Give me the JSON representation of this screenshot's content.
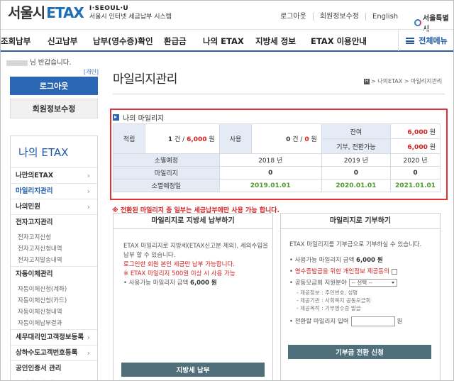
{
  "header": {
    "logo_main": "서울시",
    "logo_etax": "ETAX",
    "logo_sub1": "I·SEOUL·U",
    "logo_sub2": "서울시 인터넷 세금납부 시스템",
    "links": [
      "로그아웃",
      "회원정보수정",
      "English"
    ],
    "seoul_logo": "서울특별시"
  },
  "nav": {
    "items": [
      "조회납부",
      "신고납부",
      "납부(영수증)확인",
      "환급금",
      "나의 ETAX",
      "지방세 정보",
      "ETAX 이용안내"
    ],
    "all_menu": "전체메뉴"
  },
  "sidebar": {
    "greeting": "님 반갑습니다.",
    "open_label": "[개인]",
    "logout_label": "로그아웃",
    "member_edit_label": "회원정보수정",
    "title": "나의 ETAX",
    "items": [
      {
        "label": "나만의ETAX",
        "active": false,
        "subs": []
      },
      {
        "label": "마일리지관리",
        "active": true,
        "subs": []
      },
      {
        "label": "나의민원",
        "active": false,
        "subs": []
      },
      {
        "label": "전자고지관리",
        "active": false,
        "subs": [
          "전자고지신청",
          "전자고지신청내역",
          "전자고지발송내역"
        ]
      },
      {
        "label": "자동이체관리",
        "active": false,
        "subs": [
          "자동이체신청(계좌)",
          "자동이체신청(카드)",
          "자동이체신청내역",
          "자동이체납부결과"
        ]
      },
      {
        "label": "세무대리인고객정보등록",
        "active": false,
        "subs": []
      },
      {
        "label": "상하수도고객번호등록",
        "active": false,
        "subs": []
      },
      {
        "label": "공인인증서 관리",
        "active": false,
        "subs": [
          "공인인증서(재)등록"
        ]
      }
    ]
  },
  "main": {
    "page_title": "마일리지관리",
    "breadcrumb": "> 나의ETAX > 마일리지관리",
    "section_title": "나의 마일리지",
    "summary": {
      "earn_label": "적립",
      "earn_value": "1 건 / 6,000 원",
      "use_label": "사용",
      "use_value": "0 건 / 0 원",
      "balance_label": "잔여",
      "balance_value": "6,000 원",
      "donate_label": "기부, 전환가능",
      "donate_value": "6,000 원"
    },
    "expiry": {
      "h_label": "소멸예정",
      "years": [
        "2018 년",
        "2019 년",
        "2020 년"
      ],
      "m_label": "마일리지",
      "mileage": [
        "0",
        "0",
        "0"
      ],
      "d_label": "소멸예정일",
      "dates": [
        "2019.01.01",
        "2020.01.01",
        "2021.01.01"
      ]
    },
    "warning": "※ 전환된 마일리지 중 일부는 세금납부에만 사용 가능 합니다.",
    "left_panel": {
      "title": "마일리지로 지방세 납부하기",
      "desc1": "ETAX 마일리지로 지방세(ETAX신고분 제외), 세외수입을",
      "desc2": "납부 할 수 있습니다.",
      "red1": "로그인한 회원 본인 세금만 납부 가능합니다.",
      "red2": "※ ETAX 마일리지 500원 이상 시 사용 가능",
      "avail_label": "사용가능 마일리지 금액",
      "avail_value": "6,000 원",
      "button": "지방세 납부"
    },
    "right_panel": {
      "title": "마일리지로 기부하기",
      "desc": "ETAX 마일리지를 기부금으로 기부하실 수 있습니다.",
      "avail_label": "사용가능 마일리지 금액",
      "avail_value": "6,000 원",
      "consent_label": "영수증발급을 위한 개인정보 제공동의",
      "org_label": "공동모금회 지원분야",
      "select_value": "-- 선택 --",
      "info1": "- 제공정보 : 주민번호, 성명",
      "info2": "- 제공기관 : 사회복지 공동모금회",
      "info3": "- 제공목적 : 기부영수증 발급",
      "amount_label": "전환할 마일리지 입력",
      "amount_unit": "원",
      "button": "기부금 전환 신청"
    }
  }
}
